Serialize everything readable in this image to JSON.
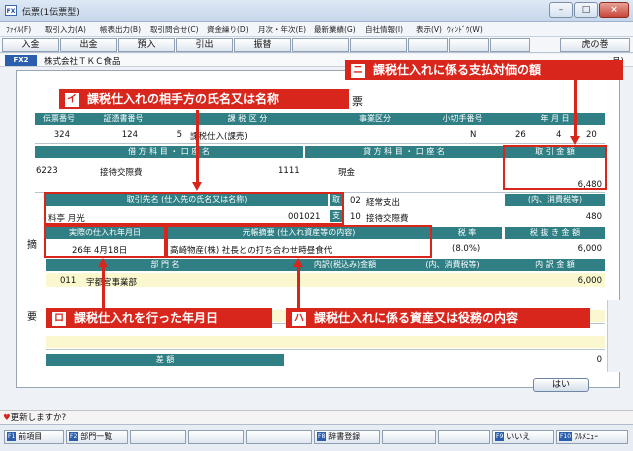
{
  "window": {
    "title": "伝票(1伝票型)",
    "app_icon": "FX",
    "minimize": "–",
    "maximize": "□",
    "close": "×"
  },
  "menu": [
    "ﾌｧｲﾙ(F)",
    "取引入力(A)",
    "帳表出力(B)",
    "取引問合せ(C)",
    "資金繰り(D)",
    "月次・年次(E)",
    "最新業績(G)",
    "自社情報(I)",
    "表示(V)",
    "ｳｨﾝﾄﾞｳ(W)"
  ],
  "function_buttons": [
    "入金",
    "出金",
    "預入",
    "引出",
    "振替",
    "",
    "",
    "",
    "",
    "",
    "虎の巻"
  ],
  "company": {
    "badge": "FX2",
    "name": "株式会社ＴＫＣ食品",
    "right_text": "月)"
  },
  "voucher": {
    "title": "票",
    "header1": {
      "denpyo_no": "伝票番号",
      "shohyo_no": "証憑書番号",
      "zeikubun": "課 税 区 分",
      "jigyo_kubun": "事業区分",
      "kogitte": "小切手番号",
      "date": "年 月 日"
    },
    "row1": {
      "denpyo_no": "324",
      "shohyo_no": "124",
      "zei_code": "5",
      "zei_name": "課税仕入(課売)",
      "kogitte": "N",
      "year": "26",
      "month": "4",
      "day": "20"
    },
    "header2": {
      "debit": "借 方 科 目 ・ 口 座 名",
      "credit": "貸 方 科 目 ・ 口 座 名",
      "amount": "取 引 金 額"
    },
    "row2": {
      "debit_code": "6223",
      "debit_name": "接待交際費",
      "credit_code": "1111",
      "credit_name": "現金",
      "amount": "6,480"
    },
    "partner_header": "取引先名 (仕入先の氏名又は名称)",
    "partner_tag": "取",
    "partner_name": "料亭 月光",
    "partner_code": "001021",
    "partner_tag2": "支",
    "acct_rows": [
      {
        "code": "02",
        "name": "経常支出"
      },
      {
        "code": "10",
        "name": "接待交際費"
      }
    ],
    "tax_header": "(内、消費税等)",
    "tax_value": "480",
    "date_header": "実際の仕入れ年月日",
    "date_value": "26年 4月18日",
    "tekiyo_header": "元帳摘要 (仕入れ資産等の内容)",
    "tekiyo_value": "高崎物産(株) 社長との打ち合わせ時昼食代",
    "rate_header": "税 率",
    "rate_value": "(8.0%)",
    "notax_header": "税 抜 き 金 額",
    "notax_value": "6,000",
    "side_labels": [
      "摘",
      "要"
    ],
    "dept_headers": [
      "部 門 名",
      "内訳(税込み)金額",
      "(内、消費税等)",
      "内 訳 金 額"
    ],
    "dept_row": {
      "code": "011",
      "name": "宇都宮事業部",
      "amount": "6,000"
    },
    "total_label": "差 額",
    "total_value": "0",
    "ok_label": "はい"
  },
  "annotations": {
    "i": {
      "badge": "イ",
      "text": "課税仕入れの相手方の氏名又は名称"
    },
    "ro": {
      "badge": "ロ",
      "text": "課税仕入れを行った年月日"
    },
    "ha": {
      "badge": "ハ",
      "text": "課税仕入れに係る資産又は役務の内容"
    },
    "ni": {
      "badge": "ニ",
      "text": "課税仕入れに係る支払対価の額"
    }
  },
  "status_text": "更新しますか?",
  "bottom_keys": [
    {
      "key": "F1",
      "label": "前項目"
    },
    {
      "key": "F2",
      "label": "部門一覧"
    },
    {
      "key": "F8",
      "label": "辞書登録"
    },
    {
      "key": "F9",
      "label": "いいえ"
    },
    {
      "key": "F10",
      "label": "ﾌﾙﾒﾆｭｰ"
    }
  ],
  "colors": {
    "header_teal": "#2f7f85",
    "annotation_red": "#d9261c",
    "row_yellow": "#fbf8cf",
    "fn_blue": "#2b5fae"
  }
}
